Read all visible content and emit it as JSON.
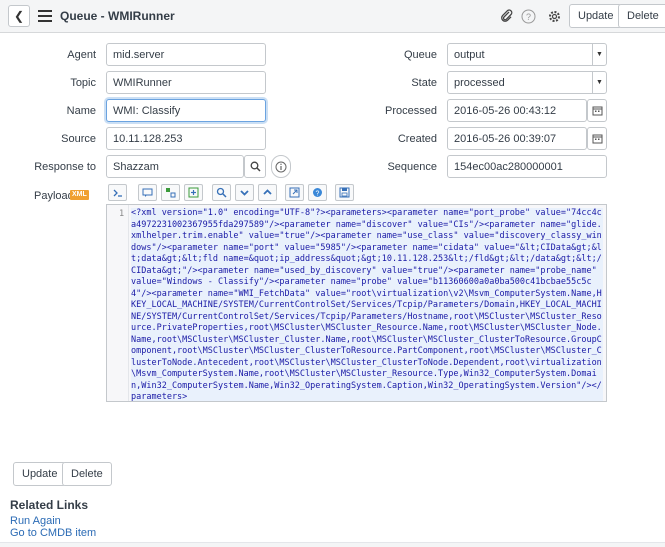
{
  "header": {
    "title": "Queue - WMIRunner",
    "update_label": "Update",
    "delete_label": "Delete"
  },
  "form": {
    "agent": {
      "label": "Agent",
      "value": "mid.server"
    },
    "topic": {
      "label": "Topic",
      "value": "WMIRunner"
    },
    "name": {
      "label": "Name",
      "value": "WMI: Classify"
    },
    "source": {
      "label": "Source",
      "value": "10.11.128.253"
    },
    "response_to": {
      "label": "Response to",
      "value": "Shazzam"
    },
    "queue": {
      "label": "Queue",
      "value": "output"
    },
    "state": {
      "label": "State",
      "value": "processed"
    },
    "processed": {
      "label": "Processed",
      "value": "2016-05-26 00:43:12"
    },
    "created": {
      "label": "Created",
      "value": "2016-05-26 00:39:07"
    },
    "sequence": {
      "label": "Sequence",
      "value": "154ec00ac280000001"
    },
    "payload": {
      "label": "Payload",
      "badge": "XML",
      "line_number": "1",
      "code": "<?xml version=\"1.0\" encoding=\"UTF-8\"?><parameters><parameter name=\"port_probe\" value=\"74cc4ca4972231002367955fda297589\"/><parameter name=\"discover\" value=\"CIs\"/><parameter name=\"glide.xmlhelper.trim.enable\" value=\"true\"/><parameter name=\"use_class\" value=\"discovery_classy_windows\"/><parameter name=\"port\" value=\"5985\"/><parameter name=\"cidata\" value=\"&lt;CIData&gt;&lt;data&gt;&lt;fld name=&quot;ip_address&quot;&gt;10.11.128.253&lt;/fld&gt;&lt;/data&gt;&lt;/CIData&gt;\"/><parameter name=\"used_by_discovery\" value=\"true\"/><parameter name=\"probe_name\" value=\"Windows - Classify\"/><parameter name=\"probe\" value=\"b11360600a0a0ba500c41bcbae55c5c4\"/><parameter name=\"WMI_FetchData\" value=\"root\\virtualization\\v2\\Msvm_ComputerSystem.Name,HKEY_LOCAL_MACHINE/SYSTEM/CurrentControlSet/Services/Tcpip/Parameters/Domain,HKEY_LOCAL_MACHINE/SYSTEM/CurrentControlSet/Services/Tcpip/Parameters/Hostname,root\\MSCluster\\MSCluster_Resource.PrivateProperties,root\\MSCluster\\MSCluster_Resource.Name,root\\MSCluster\\MSCluster_Node.Name,root\\MSCluster\\MSCluster_Cluster.Name,root\\MSCluster\\MSCluster_ClusterToResource.GroupComponent,root\\MSCluster\\MSCluster_ClusterToResource.PartComponent,root\\MSCluster\\MSCluster_ClusterToNode.Antecedent,root\\MSCluster\\MSCluster_ClusterToNode.Dependent,root\\virtualization\\Msvm_ComputerSystem.Name,root\\MSCluster\\MSCluster_Resource.Type,Win32_ComputerSystem.Domain,Win32_ComputerSystem.Name,Win32_OperatingSystem.Caption,Win32_OperatingSystem.Version\"/></parameters>"
    }
  },
  "bottom": {
    "update_label": "Update",
    "delete_label": "Delete"
  },
  "related": {
    "title": "Related Links",
    "links": [
      "Run Again",
      "Go to CMDB item"
    ]
  }
}
